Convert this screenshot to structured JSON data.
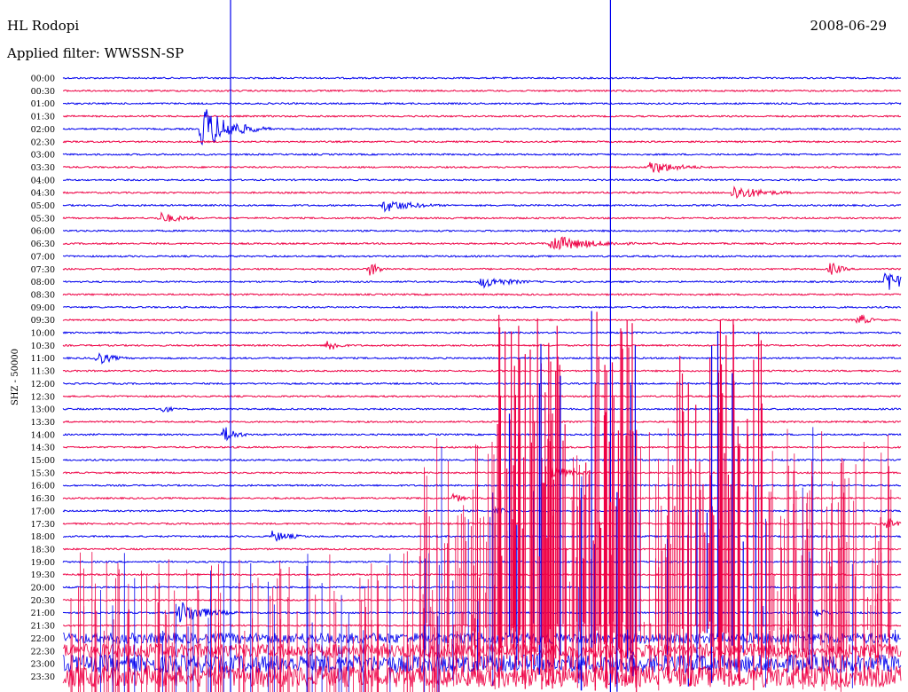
{
  "header": {
    "station": "HL Rodopi",
    "date": "2008-06-29",
    "filter_label": "Applied filter: WWSSN-SP"
  },
  "chart_data": {
    "type": "line",
    "title": "HL Rodopi",
    "subtitle": "Applied filter: WWSSN-SP",
    "ylabel": "SHZ - 50000",
    "row_labels": [
      "00:00",
      "00:30",
      "01:00",
      "01:30",
      "02:00",
      "02:30",
      "03:00",
      "03:30",
      "04:00",
      "04:30",
      "05:00",
      "05:30",
      "06:00",
      "06:30",
      "07:00",
      "07:30",
      "08:00",
      "08:30",
      "09:00",
      "09:30",
      "10:00",
      "10:30",
      "11:00",
      "11:30",
      "12:00",
      "12:30",
      "13:00",
      "13:30",
      "14:00",
      "14:30",
      "15:00",
      "15:30",
      "16:00",
      "16:30",
      "17:00",
      "17:30",
      "18:00",
      "18:30",
      "19:00",
      "19:30",
      "20:00",
      "20:30",
      "21:00",
      "21:30",
      "22:00",
      "22:30",
      "23:00",
      "23:30"
    ],
    "series_colors": [
      "#0000ee",
      "#ee0044"
    ],
    "minutes_per_row": 30,
    "vertical_markers_minute": [
      6,
      19.6
    ],
    "events": [
      {
        "row": 4,
        "minute": 5,
        "amp": 28,
        "dur": 2.5
      },
      {
        "row": 7,
        "minute": 21,
        "amp": 8,
        "dur": 3
      },
      {
        "row": 9,
        "minute": 24,
        "amp": 9,
        "dur": 3
      },
      {
        "row": 10,
        "minute": 11.5,
        "amp": 8,
        "dur": 3
      },
      {
        "row": 11,
        "minute": 3.5,
        "amp": 7,
        "dur": 2
      },
      {
        "row": 13,
        "minute": 17.5,
        "amp": 10,
        "dur": 4
      },
      {
        "row": 15,
        "minute": 11,
        "amp": 9,
        "dur": 1
      },
      {
        "row": 15,
        "minute": 27.5,
        "amp": 9,
        "dur": 1
      },
      {
        "row": 16,
        "minute": 15,
        "amp": 7,
        "dur": 3
      },
      {
        "row": 16,
        "minute": 29.5,
        "amp": 18,
        "dur": 1.5
      },
      {
        "row": 19,
        "minute": 28.5,
        "amp": 8,
        "dur": 1
      },
      {
        "row": 21,
        "minute": 9.5,
        "amp": 9,
        "dur": 1
      },
      {
        "row": 22,
        "minute": 1.2,
        "amp": 9,
        "dur": 1.5
      },
      {
        "row": 26,
        "minute": 3.5,
        "amp": 6,
        "dur": 1
      },
      {
        "row": 28,
        "minute": 5.8,
        "amp": 10,
        "dur": 1.2
      },
      {
        "row": 31,
        "minute": 17.5,
        "amp": 8,
        "dur": 2
      },
      {
        "row": 33,
        "minute": 14,
        "amp": 6,
        "dur": 1
      },
      {
        "row": 34,
        "minute": 15.5,
        "amp": 6,
        "dur": 1
      },
      {
        "row": 35,
        "minute": 29.5,
        "amp": 8,
        "dur": 1
      },
      {
        "row": 36,
        "minute": 7.5,
        "amp": 7,
        "dur": 2
      },
      {
        "row": 42,
        "minute": 4.2,
        "amp": 14,
        "dur": 2.5
      },
      {
        "row": 42,
        "minute": 27,
        "amp": 6,
        "dur": 1
      }
    ]
  }
}
